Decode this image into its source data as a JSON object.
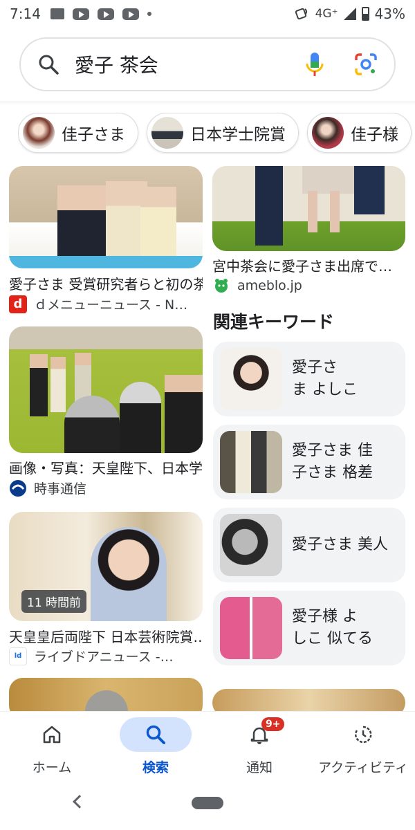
{
  "status_bar": {
    "time": "7:14",
    "network": "4G⁺",
    "battery": "43%"
  },
  "search": {
    "query": "愛子 茶会"
  },
  "chips": [
    {
      "label": "佳子さま"
    },
    {
      "label": "日本学士院賞"
    },
    {
      "label": "佳子様"
    }
  ],
  "results": {
    "left": [
      {
        "title": "愛子さま 受賞研究者らと初の茶会…",
        "source": "ｄメニューニュース - N…"
      },
      {
        "title": "画像・写真：天皇陛下、日本学士院…",
        "source": "時事通信"
      },
      {
        "title": "天皇皇后両陛下 日本芸術院賞…",
        "source": "ライブドアニュース -…",
        "badge": "11 時間前"
      }
    ],
    "right": [
      {
        "title": "宮中茶会に愛子さま出席で…",
        "source": "ameblo.jp"
      }
    ],
    "related_heading": "関連キーワード",
    "related": [
      {
        "label": "愛子さ\nま よしこ"
      },
      {
        "label": "愛子さま 佳\n子さま 格差"
      },
      {
        "label": "愛子さま 美人"
      },
      {
        "label": "愛子様 よ\nしこ 似てる"
      }
    ]
  },
  "bottom_nav": {
    "items": [
      {
        "label": "ホーム"
      },
      {
        "label": "検索"
      },
      {
        "label": "通知",
        "badge": "9+"
      },
      {
        "label": "アクティビティ"
      }
    ]
  },
  "colors": {
    "accent": "#0b57d0",
    "active_pill": "#d3e3fd",
    "badge_red": "#d93025",
    "keyword_card_bg": "#f1f3f4"
  }
}
